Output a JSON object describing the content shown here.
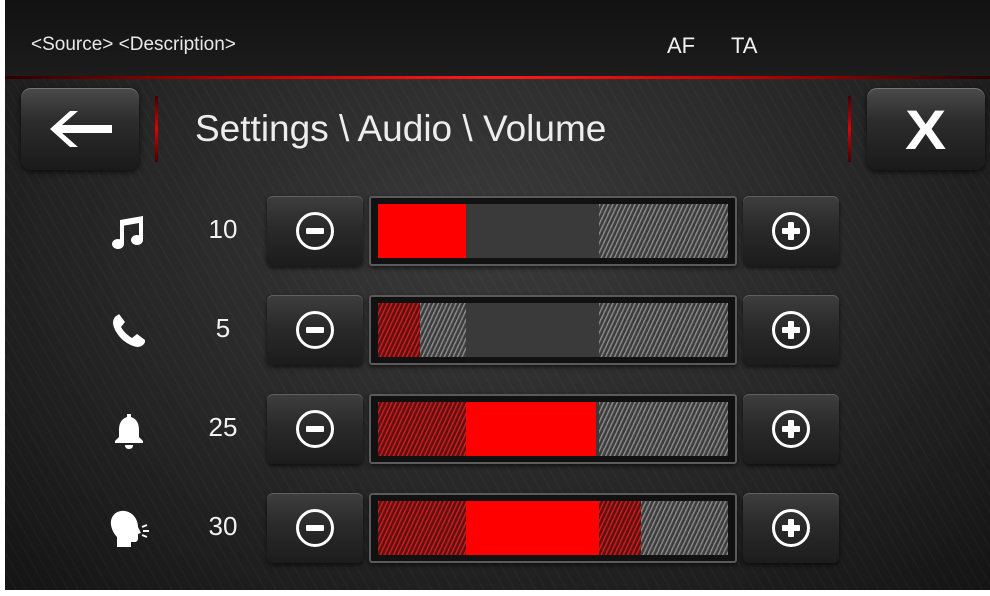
{
  "status": {
    "source_description": "<Source> <Description>",
    "af": "AF",
    "ta": "TA"
  },
  "header": {
    "title": "Settings \\ Audio \\ Volume",
    "back_icon": "arrow-left-icon",
    "close_label": "X"
  },
  "colors": {
    "accent": "#ff0000",
    "background": "#262626"
  },
  "volumes": [
    {
      "id": "music",
      "icon": "music-note-icon",
      "value": "10",
      "min_level": 0.0,
      "level": 0.25,
      "upper": 0.63
    },
    {
      "id": "phone",
      "icon": "phone-icon",
      "value": "5",
      "min_level": 0.12,
      "level": 0.12,
      "upper": 0.63
    },
    {
      "id": "alert",
      "icon": "bell-icon",
      "value": "25",
      "min_level": 0.25,
      "level": 0.62,
      "upper": 0.62
    },
    {
      "id": "voice",
      "icon": "speaking-head-icon",
      "value": "30",
      "min_level": 0.25,
      "level": 0.63,
      "upper": 0.75
    }
  ]
}
